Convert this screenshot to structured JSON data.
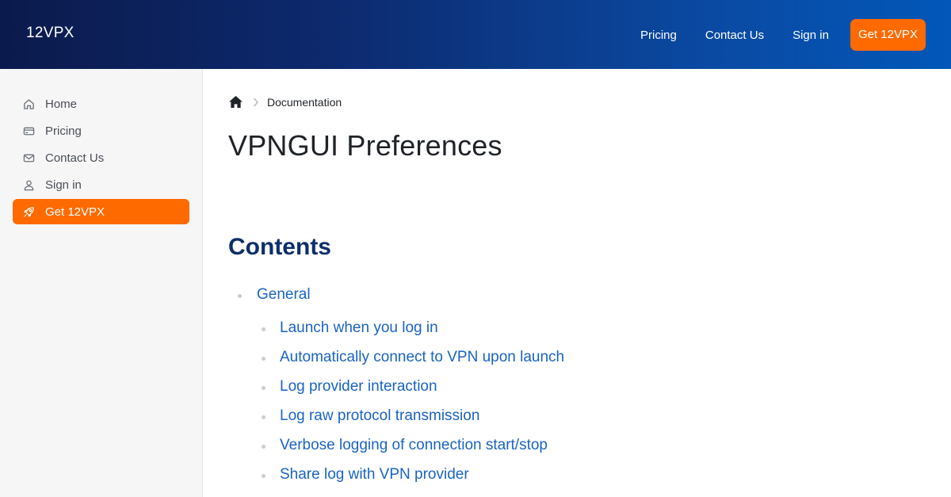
{
  "header": {
    "brand": "12VPX",
    "nav": [
      {
        "label": "Pricing"
      },
      {
        "label": "Contact Us"
      },
      {
        "label": "Sign in"
      }
    ],
    "cta_label": "Get 12VPX",
    "cta_color": "#ff6a00"
  },
  "sidebar": {
    "items": [
      {
        "label": "Home",
        "icon": "home-icon"
      },
      {
        "label": "Pricing",
        "icon": "credit-card-icon"
      },
      {
        "label": "Contact Us",
        "icon": "mail-icon"
      },
      {
        "label": "Sign in",
        "icon": "user-icon"
      },
      {
        "label": "Get 12VPX",
        "icon": "rocket-icon",
        "active": true
      }
    ]
  },
  "breadcrumb": {
    "home_icon": "home-icon",
    "current": "Documentation"
  },
  "page": {
    "title": "VPNGUI Preferences",
    "contents_heading": "Contents",
    "toc": {
      "section": "General",
      "items": [
        "Launch when you log in",
        "Automatically connect to VPN upon launch",
        "Log provider interaction",
        "Log raw protocol transmission",
        "Verbose logging of connection start/stop",
        "Share log with VPN provider"
      ]
    }
  },
  "colors": {
    "accent": "#ff6a00",
    "link": "#1a63c4",
    "heading": "#0d2f6a",
    "header_gradient_start": "#0b1a4c",
    "header_gradient_end": "#0257b8"
  }
}
